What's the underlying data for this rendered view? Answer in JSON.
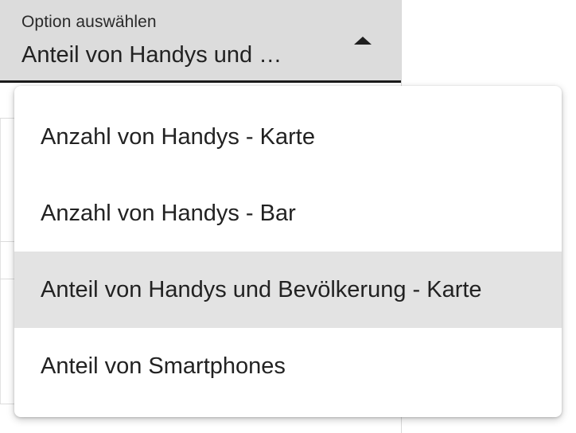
{
  "select": {
    "label": "Option auswählen",
    "value": "Anteil von Handys und …",
    "caret_icon": "caret-up-icon"
  },
  "menu": {
    "items": [
      {
        "label": "Anzahl von Handys - Karte",
        "selected": false
      },
      {
        "label": "Anzahl von Handys - Bar",
        "selected": false
      },
      {
        "label": "Anteil von Handys und Bevölkerung - Karte",
        "selected": true
      },
      {
        "label": "Anteil von Smartphones",
        "selected": false
      }
    ]
  },
  "colors": {
    "field_background": "#dcdcdc",
    "field_underline": "#1b1b1b",
    "menu_background": "#ffffff",
    "selected_item_background": "#e3e3e3",
    "text": "#222222"
  }
}
